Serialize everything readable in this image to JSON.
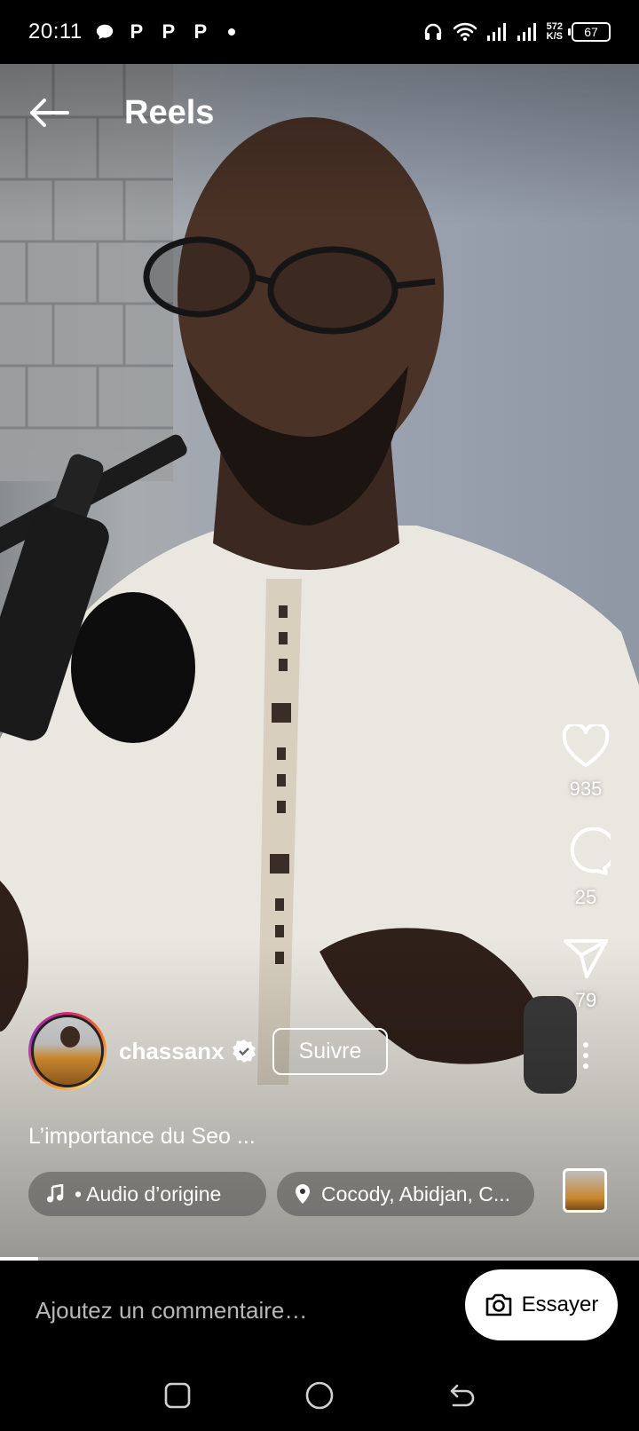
{
  "status_bar": {
    "time": "20:11",
    "notifications": [
      "P",
      "P",
      "P"
    ],
    "net_speed_value": "572",
    "net_speed_unit": "K/S",
    "battery": "67"
  },
  "header": {
    "title": "Reels",
    "back_icon": "arrow-left-icon"
  },
  "actions": {
    "likes": "935",
    "comments": "25",
    "shares": "79"
  },
  "author": {
    "username": "chassanx",
    "verified": true,
    "follow_label": "Suivre"
  },
  "caption": "L’importance du Seo ...",
  "chips": {
    "audio": "• Audio d’origine",
    "location": "Cocody, Abidjan, C..."
  },
  "progress": {
    "fraction": 0.06
  },
  "comment_bar": {
    "placeholder": "Ajoutez un commentaire…",
    "try_label": "Essayer"
  },
  "colors": {
    "accent_ring": "#d62976",
    "background": "#000000"
  }
}
